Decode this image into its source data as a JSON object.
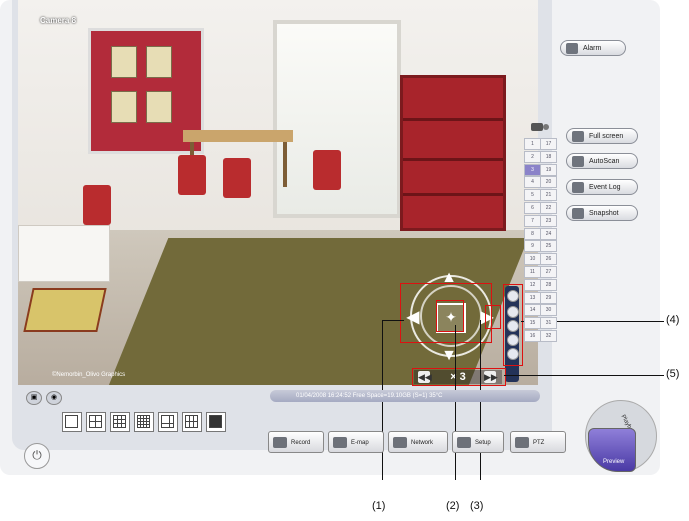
{
  "video": {
    "camera_label": "Camera 8",
    "watermark": "©Nemorbin_Olivo Graphics"
  },
  "ptz": {
    "speed_value": "× 3"
  },
  "status_bar": {
    "text": "01/04/2008 16:24:52  Free Space=19.10GB (S=1) 35°C"
  },
  "right_buttons": {
    "alarm": "Alarm",
    "full_screen": "Full screen",
    "autoscan": "AutoScan",
    "event_log": "Event Log",
    "snapshot": "Snapshot"
  },
  "channels": {
    "left": [
      "1",
      "2",
      "3",
      "4",
      "5",
      "6",
      "7",
      "8",
      "9",
      "10",
      "11",
      "12",
      "13",
      "14",
      "15",
      "16"
    ],
    "right": [
      "17",
      "18",
      "19",
      "20",
      "21",
      "22",
      "23",
      "24",
      "25",
      "26",
      "27",
      "28",
      "29",
      "30",
      "31",
      "32"
    ],
    "selected": "3"
  },
  "bottom_buttons": {
    "record": "Record",
    "emap": "E-map",
    "network": "Network",
    "setup": "Setup",
    "ptz": "PTZ"
  },
  "mode": {
    "playback": "Playback",
    "preview": "Preview"
  },
  "callouts": {
    "c1": "(1)",
    "c2": "(2)",
    "c3": "(3)",
    "c4": "(4)",
    "c5": "(5)"
  }
}
